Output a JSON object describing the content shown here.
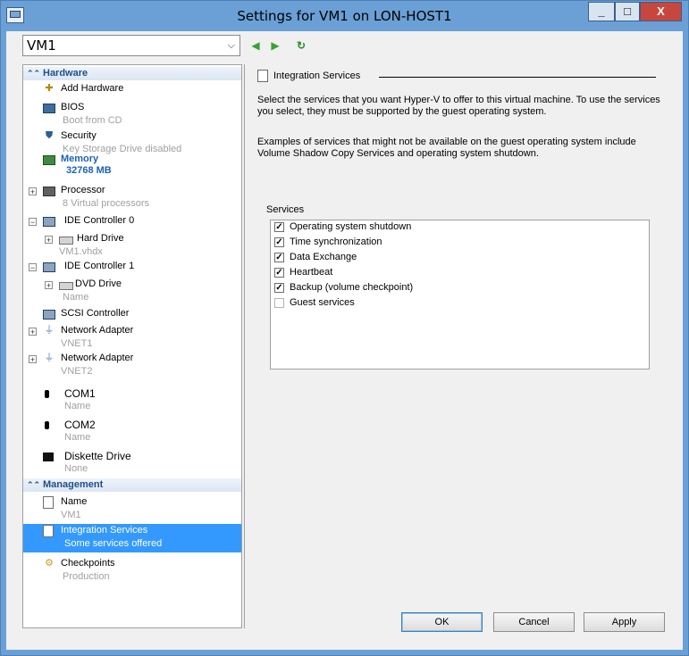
{
  "window": {
    "title": "Settings for VM1  on LON-HOST1",
    "controls": {
      "minimize": "_",
      "maximize": "□",
      "close": "X"
    }
  },
  "vm_selector": {
    "value": "VM1"
  },
  "toolbar": {
    "back": "◀",
    "forward": "▶",
    "refresh": "↻"
  },
  "sidebar": {
    "hardware_header": "Hardware",
    "management_header": "Management",
    "items": [
      {
        "label": "Add Hardware",
        "sub": "",
        "icon": "add-hardware-icon"
      },
      {
        "label": "BIOS",
        "sub": "Boot from CD",
        "icon": "bios-icon"
      },
      {
        "label": "Security",
        "sub": "Key Storage Drive disabled",
        "icon": "security-icon"
      },
      {
        "label": "Memory",
        "sub": "32768 MB",
        "icon": "memory-icon"
      },
      {
        "label": "Processor",
        "sub": "8 Virtual processors",
        "icon": "processor-icon"
      },
      {
        "label": "IDE Controller  0",
        "sub": "",
        "icon": "ide-controller-icon"
      },
      {
        "label": "Hard Drive",
        "sub": "VM1.vhdx",
        "icon": "hard-drive-icon"
      },
      {
        "label": "IDE Controller  1",
        "sub": "",
        "icon": "ide-controller-icon"
      },
      {
        "label": "DVD Drive",
        "sub": "Name",
        "icon": "dvd-drive-icon"
      },
      {
        "label": "SCSI Controller",
        "sub": "",
        "icon": "scsi-controller-icon"
      },
      {
        "label": "Network Adapter",
        "sub": "VNET1",
        "icon": "network-adapter-icon"
      },
      {
        "label": "Network Adapter",
        "sub": "VNET2",
        "icon": "network-adapter-icon"
      },
      {
        "label": "COM1",
        "sub": "Name",
        "icon": "com-port-icon"
      },
      {
        "label": "COM2",
        "sub": "Name",
        "icon": "com-port-icon"
      },
      {
        "label": "Diskette Drive",
        "sub": "None",
        "icon": "diskette-drive-icon"
      },
      {
        "label": "Name",
        "sub": "VM1",
        "icon": "name-icon"
      },
      {
        "label": "Integration Services",
        "sub": "Some services offered",
        "icon": "integration-services-icon"
      },
      {
        "label": "Checkpoints",
        "sub": "Production",
        "icon": "checkpoints-icon"
      }
    ]
  },
  "details": {
    "group_title": "Integration Services",
    "para1": "Select the services that you want Hyper-V to offer to this virtual machine. To use the services you select, they must be supported by the guest operating system.",
    "para2": "Examples of services that might not be available on the guest operating system include Volume Shadow Copy Services and operating system shutdown.",
    "services_label": "Services",
    "services": [
      {
        "label": "Operating system shutdown",
        "checked": true
      },
      {
        "label": "Time synchronization",
        "checked": true
      },
      {
        "label": "Data Exchange",
        "checked": true
      },
      {
        "label": "Heartbeat",
        "checked": true
      },
      {
        "label": "Backup (volume checkpoint)",
        "checked": true
      },
      {
        "label": "Guest services",
        "checked": false
      }
    ],
    "check_mark": "✓"
  },
  "buttons": {
    "ok": "OK",
    "cancel": "Cancel",
    "apply": "Apply"
  }
}
